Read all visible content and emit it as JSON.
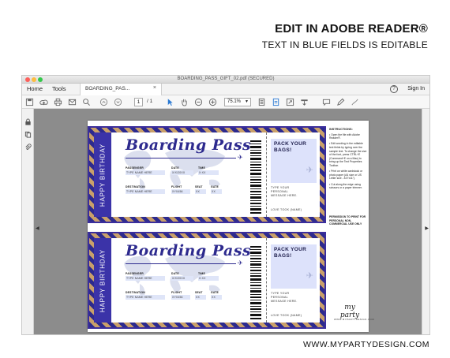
{
  "promo": {
    "heading": "EDIT IN ADOBE READER®",
    "subheading": "TEXT IN BLUE FIELDS IS EDITABLE",
    "website": "WWW.MYPARTYDESIGN.COM"
  },
  "window": {
    "title": "BOARDING_PASS_GIFT_02.pdf (SECURED)",
    "menu": {
      "home": "Home",
      "tools": "Tools",
      "sign_in": "Sign In"
    },
    "tab": {
      "label": "BOARDING_PAS...",
      "close": "×"
    },
    "toolbar": {
      "page_current": "1",
      "page_count": "/ 1",
      "zoom": "75.1%"
    }
  },
  "tickets": [
    {
      "title": "Boarding Pass",
      "band_text": "HAPPY BIRTHDAY",
      "fields": {
        "passenger": {
          "label": "PASSENGER",
          "value": "TYPE NAME HERE"
        },
        "date": {
          "label": "DATE",
          "value": "X/X/20XX"
        },
        "time": {
          "label": "TIME",
          "value": "X:XX"
        },
        "destination": {
          "label": "DESTINATION",
          "value": "TYPE NAME HERE"
        },
        "flight": {
          "label": "FLIGHT",
          "value": "XYX456"
        },
        "seat": {
          "label": "SEAT",
          "value": "XX"
        },
        "gate": {
          "label": "GATE",
          "value": "XX"
        }
      },
      "pack_text": [
        "PACK YOUR",
        "BAGS!"
      ],
      "message": [
        "TYPE YOUR",
        "PERSONAL",
        "MESSAGE HERE."
      ],
      "signature": "LOVE TOOK (NAME)"
    },
    {
      "title": "Boarding Pass",
      "band_text": "HAPPY BIRTHDAY",
      "fields": {
        "passenger": {
          "label": "PASSENGER",
          "value": "TYPE NAME HERE"
        },
        "date": {
          "label": "DATE",
          "value": "X/X/20XX"
        },
        "time": {
          "label": "TIME",
          "value": "X:XX"
        },
        "destination": {
          "label": "DESTINATION",
          "value": "TYPE NAME HERE"
        },
        "flight": {
          "label": "FLIGHT",
          "value": "XYX456"
        },
        "seat": {
          "label": "SEAT",
          "value": "XX"
        },
        "gate": {
          "label": "GATE",
          "value": "XX"
        }
      },
      "pack_text": [
        "PACK YOUR",
        "BAGS!"
      ],
      "message": [
        "TYPE YOUR",
        "PERSONAL",
        "MESSAGE HERE."
      ],
      "signature": "LOVE TOOK (NAME)"
    }
  ],
  "instructions": {
    "heading": "INSTRUCTIONS:",
    "items": [
      "• Open the file with Adobe Reader®.",
      "• Edit wording in the editable text fields by typing over the sample text. To change the size of the font, press CTRL+E (Command+E on a Mac) to bring up the Text Properties Toolbar.",
      "• Print on white cardstock or photo paper (A4 size or US Letter size - 8.5\"x11\").",
      "• Cut along the edge using scissors or a paper trimmer."
    ],
    "permission": "PERMISSION TO PRINT FOR PERSONAL NON-COMMERCIAL USE ONLY"
  },
  "logo": {
    "name": "my party",
    "sub": "WWW.MYPARTYDESIGN.COM"
  },
  "colors": {
    "navy": "#2d2a8e",
    "gold": "#c9a06a",
    "field_blue": "#dfe5f8"
  }
}
